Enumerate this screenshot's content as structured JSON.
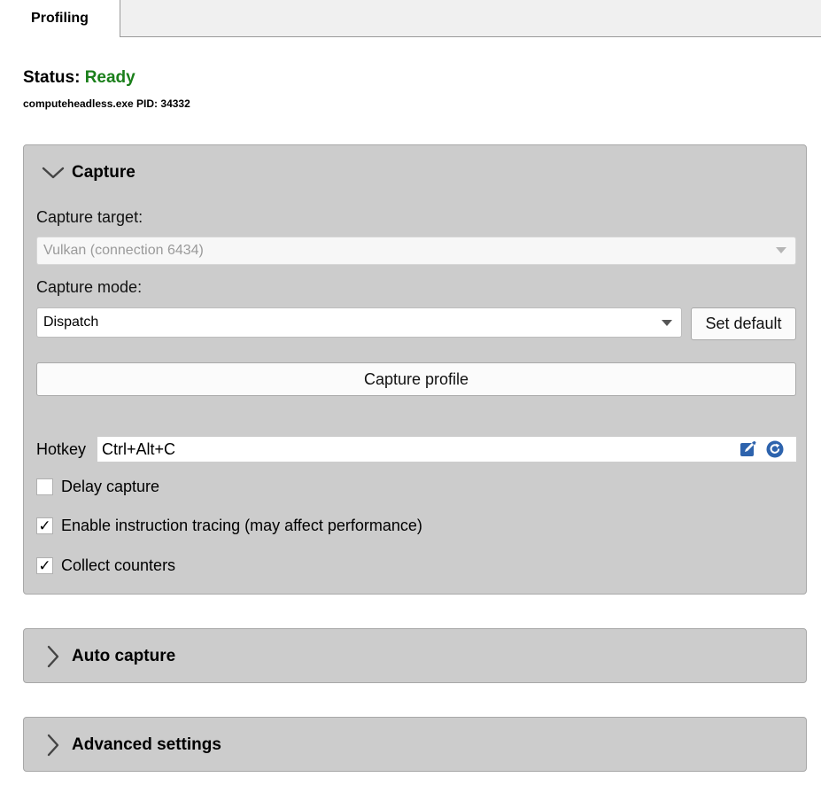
{
  "tabs": [
    {
      "label": "Profiling",
      "active": true
    }
  ],
  "status": {
    "label": "Status:",
    "value": "Ready",
    "value_color": "#1a7f1a",
    "process": "computeheadless.exe PID: 34332"
  },
  "capture_panel": {
    "title": "Capture",
    "expanded": true,
    "target_label": "Capture target:",
    "target_value": "Vulkan (connection 6434)",
    "target_disabled": true,
    "mode_label": "Capture mode:",
    "mode_value": "Dispatch",
    "set_default_label": "Set default",
    "capture_button_label": "Capture profile",
    "hotkey_label": "Hotkey",
    "hotkey_value": "Ctrl+Alt+C",
    "options": [
      {
        "label": "Delay capture",
        "checked": false
      },
      {
        "label": "Enable instruction tracing (may affect performance)",
        "checked": true
      },
      {
        "label": "Collect counters",
        "checked": true
      }
    ]
  },
  "auto_capture_panel": {
    "title": "Auto capture",
    "expanded": false
  },
  "advanced_panel": {
    "title": "Advanced settings",
    "expanded": false
  },
  "icons": {
    "expanded": "chevron-down-icon",
    "collapsed": "chevron-right-icon",
    "edit": "edit-icon",
    "reset": "reset-icon"
  },
  "colors": {
    "panel_bg": "#cccccc",
    "accent_icon": "#2d63ad"
  }
}
